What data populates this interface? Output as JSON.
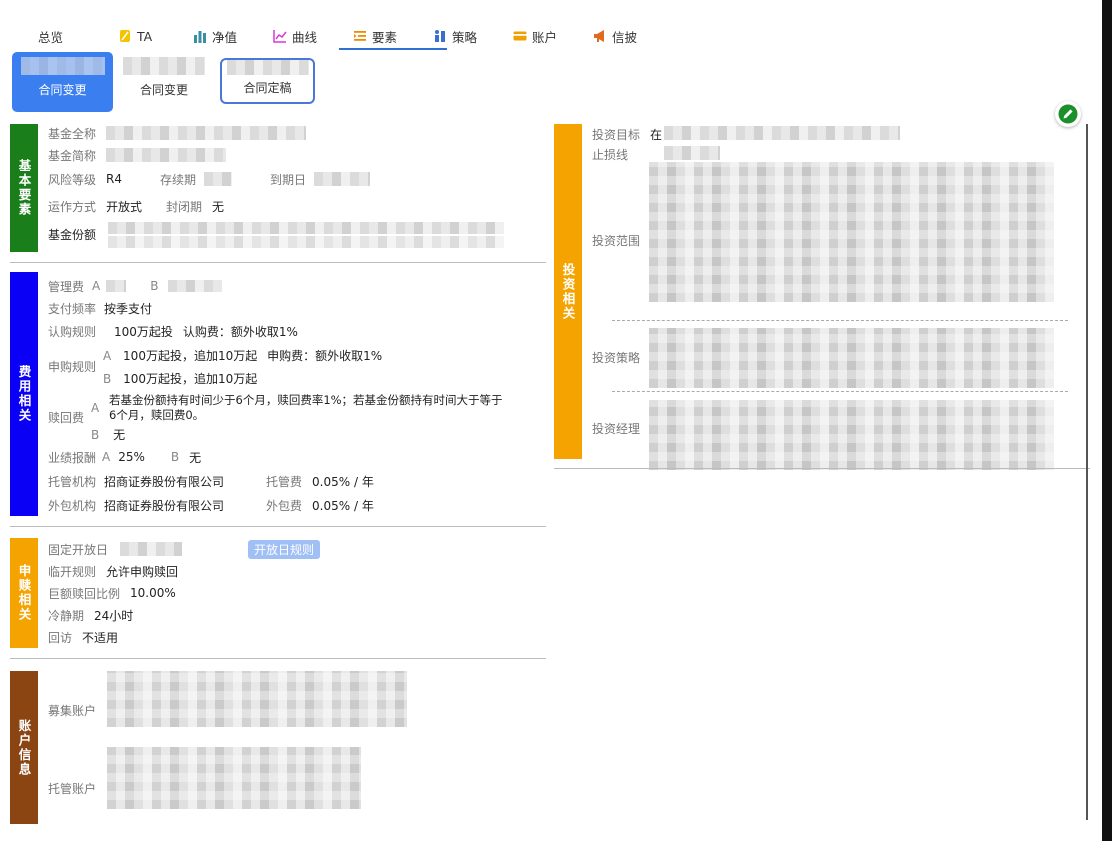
{
  "tabs": [
    {
      "label": "总览",
      "icon": "overview-icon"
    },
    {
      "label": "TA",
      "icon": "ta-icon",
      "color": "#f5c400"
    },
    {
      "label": "净值",
      "icon": "bar-chart-icon",
      "color": "#3a8fa0"
    },
    {
      "label": "曲线",
      "icon": "line-chart-icon",
      "color": "#d43bd4"
    },
    {
      "label": "要素",
      "icon": "list-icon",
      "color": "#f08a00",
      "active": true
    },
    {
      "label": "策略",
      "icon": "chess-icon",
      "color": "#3a6fd0"
    },
    {
      "label": "账户",
      "icon": "card-icon",
      "color": "#f0a000"
    },
    {
      "label": "信披",
      "icon": "megaphone-icon",
      "color": "#e06a20"
    }
  ],
  "cards": [
    {
      "label": "合同变更",
      "state": "active"
    },
    {
      "label": "合同变更",
      "state": "normal"
    },
    {
      "label": "合同定稿",
      "state": "outlined"
    }
  ],
  "basic": {
    "side": "基本要素",
    "color": "#1a7f1a",
    "full_name_label": "基金全称",
    "short_name_label": "基金简称",
    "risk_label": "风险等级",
    "risk_value": "R4",
    "duration_label": "存续期",
    "expire_label": "到期日",
    "op_label": "运作方式",
    "op_value": "开放式",
    "closed_label": "封闭期",
    "closed_value": "无",
    "share_label": "基金份额"
  },
  "fees": {
    "side": "费用相关",
    "color": "#0a00f5",
    "mgmt_label": "管理费",
    "mgmt_a": "A",
    "mgmt_b": "B",
    "pay_label": "支付频率",
    "pay_value": "按季支付",
    "sub_label": "认购规则",
    "sub_value": "100万起投",
    "sub_fee": "认购费：额外收取1%",
    "purchase_label": "申购规则",
    "purchase_a": "A",
    "purchase_a_value": "100万起投，追加10万起",
    "purchase_a_fee": "申购费：额外收取1%",
    "purchase_b": "B",
    "purchase_b_value": "100万起投，追加10万起",
    "redeem_label": "赎回费",
    "redeem_a": "A",
    "redeem_a_line1": "若基金份额持有时间少于6个月，赎回费率1%；若基金份额持有时间大于等于",
    "redeem_a_line2": "6个月，赎回费0。",
    "redeem_b": "B",
    "redeem_b_value": "无",
    "perf_label": "业绩报酬",
    "perf_a": "A",
    "perf_a_value": "25%",
    "perf_b": "B",
    "perf_b_value": "无",
    "custody_label": "托管机构",
    "custody_value": "招商证券股份有限公司",
    "custody_fee_label": "托管费",
    "custody_fee_value": "0.05% / 年",
    "outsource_label": "外包机构",
    "outsource_value": "招商证券股份有限公司",
    "outsource_fee_label": "外包费",
    "outsource_fee_value": "0.05% / 年"
  },
  "redeem": {
    "side": "申赎相关",
    "color": "#f5a300",
    "open_day_label": "固定开放日",
    "open_rule_tag": "开放日规则",
    "temp_open_label": "临开规则",
    "temp_open_value": "允许申购赎回",
    "large_label": "巨额赎回比例",
    "large_value": "10.00%",
    "cool_label": "冷静期",
    "cool_value": "24小时",
    "visit_label": "回访",
    "visit_value": "不适用"
  },
  "account": {
    "side": "账户信息",
    "color": "#8b4513",
    "raise_label": "募集账户",
    "custody_label": "托管账户"
  },
  "invest": {
    "side": "投资相关",
    "target_label": "投资目标",
    "target_prefix": "在",
    "stoploss_label": "止损线",
    "scope_label": "投资范围",
    "strategy_label": "投资策略",
    "manager_label": "投资经理"
  }
}
